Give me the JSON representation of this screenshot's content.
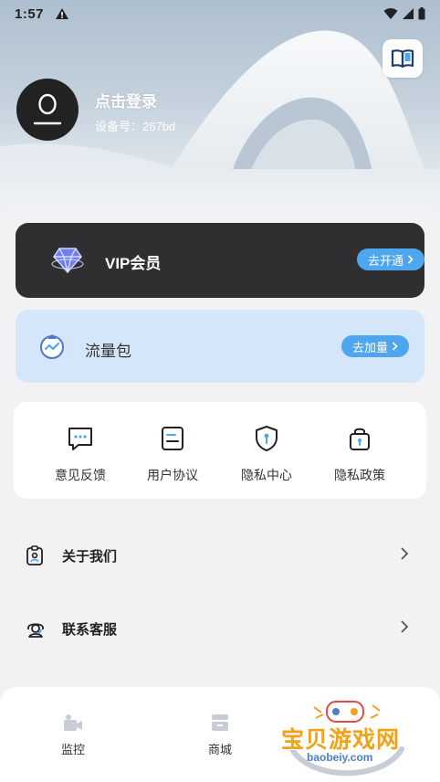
{
  "status_bar": {
    "time": "1:57"
  },
  "header": {
    "login_title": "点击登录",
    "device_id": "设备号：267bd"
  },
  "vip": {
    "label": "VIP会员",
    "action": "去开通"
  },
  "traffic": {
    "label": "流量包",
    "action": "去加量"
  },
  "quick_actions": [
    {
      "label": "意见反馈",
      "icon": "feedback-icon"
    },
    {
      "label": "用户协议",
      "icon": "agreement-icon"
    },
    {
      "label": "隐私中心",
      "icon": "privacy-shield-icon"
    },
    {
      "label": "隐私政策",
      "icon": "privacy-lock-icon"
    }
  ],
  "menu": [
    {
      "label": "关于我们",
      "icon": "badge-icon"
    },
    {
      "label": "联系客服",
      "icon": "headset-icon"
    }
  ],
  "tabs": [
    {
      "label": "监控",
      "icon": "camera-icon"
    },
    {
      "label": "商城",
      "icon": "store-icon"
    }
  ],
  "watermark": {
    "text": "宝贝游戏网",
    "url": "baobeiy.com"
  },
  "colors": {
    "accent": "#4ea6ee",
    "vip_card": "#2f2f31",
    "traffic_card": "#d5e6fb",
    "watermark": "#f2a21a"
  }
}
